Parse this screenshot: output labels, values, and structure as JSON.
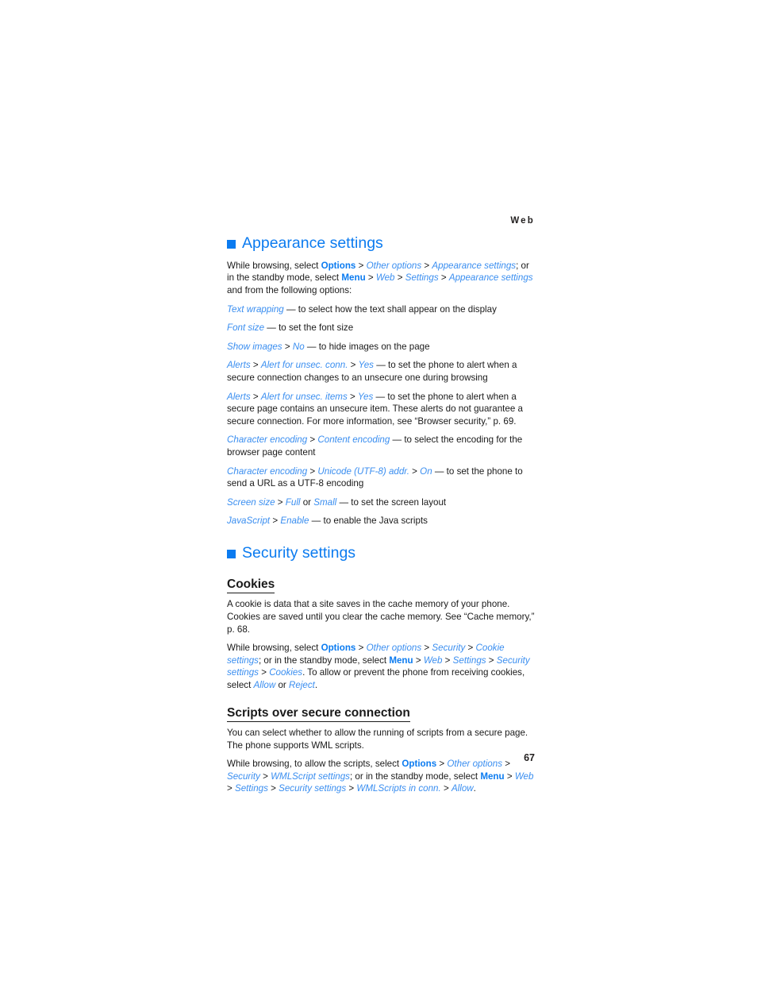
{
  "page": {
    "running_header": "Web",
    "folio": "67",
    "accent_blue": "#0b7bf0",
    "italic_blue": "#3a8ef0",
    "body_black": "#1a1a1a"
  },
  "sections": [
    {
      "id": "appearance-settings",
      "heading": "Appearance settings",
      "bullet": "square-bullet-icon",
      "intro": {
        "parts": [
          {
            "t": "plain",
            "v": "While browsing, select "
          },
          {
            "t": "bold",
            "v": "Options"
          },
          {
            "t": "sep",
            "v": " > "
          },
          {
            "t": "ital",
            "v": "Other options"
          },
          {
            "t": "sep",
            "v": " > "
          },
          {
            "t": "ital",
            "v": "Appearance settings"
          },
          {
            "t": "plain",
            "v": "; or in the standby mode, select "
          },
          {
            "t": "bold",
            "v": "Menu"
          },
          {
            "t": "sep",
            "v": " > "
          },
          {
            "t": "ital",
            "v": "Web"
          },
          {
            "t": "sep",
            "v": " > "
          },
          {
            "t": "ital",
            "v": "Settings"
          },
          {
            "t": "sep",
            "v": " > "
          },
          {
            "t": "ital",
            "v": "Appearance settings"
          },
          {
            "t": "plain",
            "v": " and from the following options:"
          }
        ]
      },
      "options": [
        {
          "parts": [
            {
              "t": "ital",
              "v": "Text wrapping"
            },
            {
              "t": "plain",
              "v": " — to select how the text shall appear on the display"
            }
          ]
        },
        {
          "parts": [
            {
              "t": "ital",
              "v": "Font size"
            },
            {
              "t": "plain",
              "v": " — to set the font size"
            }
          ]
        },
        {
          "parts": [
            {
              "t": "ital",
              "v": "Show images"
            },
            {
              "t": "sep",
              "v": " > "
            },
            {
              "t": "ital",
              "v": "No"
            },
            {
              "t": "plain",
              "v": " — to hide images on the page"
            }
          ]
        },
        {
          "parts": [
            {
              "t": "ital",
              "v": "Alerts"
            },
            {
              "t": "sep",
              "v": " > "
            },
            {
              "t": "ital",
              "v": "Alert for unsec. conn."
            },
            {
              "t": "sep",
              "v": " > "
            },
            {
              "t": "ital",
              "v": "Yes"
            },
            {
              "t": "plain",
              "v": " — to set the phone to alert when a secure connection changes to an unsecure one during browsing"
            }
          ]
        },
        {
          "parts": [
            {
              "t": "ital",
              "v": "Alerts"
            },
            {
              "t": "sep",
              "v": " > "
            },
            {
              "t": "ital",
              "v": "Alert for unsec. items"
            },
            {
              "t": "sep",
              "v": " > "
            },
            {
              "t": "ital",
              "v": "Yes"
            },
            {
              "t": "plain",
              "v": " — to set the phone to alert when a secure page contains an unsecure item. These alerts do not guarantee a secure connection. For more information, see “Browser security,” p. 69."
            }
          ]
        },
        {
          "parts": [
            {
              "t": "ital",
              "v": "Character encoding"
            },
            {
              "t": "sep",
              "v": " > "
            },
            {
              "t": "ital",
              "v": "Content encoding"
            },
            {
              "t": "plain",
              "v": " — to select the encoding for the browser page content"
            }
          ]
        },
        {
          "parts": [
            {
              "t": "ital",
              "v": "Character encoding"
            },
            {
              "t": "sep",
              "v": " > "
            },
            {
              "t": "ital",
              "v": "Unicode (UTF-8) addr."
            },
            {
              "t": "sep",
              "v": " > "
            },
            {
              "t": "ital",
              "v": "On"
            },
            {
              "t": "plain",
              "v": " — to set the phone to send a URL as a UTF-8 encoding"
            }
          ]
        },
        {
          "parts": [
            {
              "t": "ital",
              "v": "Screen size"
            },
            {
              "t": "sep",
              "v": " > "
            },
            {
              "t": "ital",
              "v": "Full"
            },
            {
              "t": "plain",
              "v": " or "
            },
            {
              "t": "ital",
              "v": "Small"
            },
            {
              "t": "plain",
              "v": " — to set the screen layout"
            }
          ]
        },
        {
          "parts": [
            {
              "t": "ital",
              "v": "JavaScript"
            },
            {
              "t": "sep",
              "v": " > "
            },
            {
              "t": "ital",
              "v": "Enable"
            },
            {
              "t": "plain",
              "v": " — to enable the Java scripts"
            }
          ]
        }
      ]
    },
    {
      "id": "security-settings",
      "heading": "Security settings",
      "bullet": "square-bullet-icon",
      "subsections": [
        {
          "id": "cookies",
          "heading": "Cookies",
          "paragraphs": [
            {
              "parts": [
                {
                  "t": "plain",
                  "v": "A cookie is data that a site saves in the cache memory of your phone. Cookies are saved until you clear the cache memory. See “Cache memory,” p. 68."
                }
              ]
            },
            {
              "parts": [
                {
                  "t": "plain",
                  "v": "While browsing, select "
                },
                {
                  "t": "bold",
                  "v": "Options"
                },
                {
                  "t": "sep",
                  "v": " > "
                },
                {
                  "t": "ital",
                  "v": "Other options"
                },
                {
                  "t": "sep",
                  "v": " > "
                },
                {
                  "t": "ital",
                  "v": "Security"
                },
                {
                  "t": "sep",
                  "v": " > "
                },
                {
                  "t": "ital",
                  "v": "Cookie settings"
                },
                {
                  "t": "plain",
                  "v": "; or in the standby mode, select "
                },
                {
                  "t": "bold",
                  "v": "Menu"
                },
                {
                  "t": "sep",
                  "v": " > "
                },
                {
                  "t": "ital",
                  "v": "Web"
                },
                {
                  "t": "sep",
                  "v": " > "
                },
                {
                  "t": "ital",
                  "v": "Settings"
                },
                {
                  "t": "sep",
                  "v": " > "
                },
                {
                  "t": "ital",
                  "v": "Security settings"
                },
                {
                  "t": "sep",
                  "v": " > "
                },
                {
                  "t": "ital",
                  "v": "Cookies"
                },
                {
                  "t": "plain",
                  "v": ". To allow or prevent the phone from receiving cookies, select "
                },
                {
                  "t": "ital",
                  "v": "Allow"
                },
                {
                  "t": "plain",
                  "v": " or "
                },
                {
                  "t": "ital",
                  "v": "Reject"
                },
                {
                  "t": "plain",
                  "v": "."
                }
              ]
            }
          ]
        },
        {
          "id": "scripts-over-secure-connection",
          "heading": "Scripts over secure connection",
          "paragraphs": [
            {
              "parts": [
                {
                  "t": "plain",
                  "v": "You can select whether to allow the running of scripts from a secure page. The phone supports WML scripts."
                }
              ]
            },
            {
              "parts": [
                {
                  "t": "plain",
                  "v": "While browsing, to allow the scripts, select "
                },
                {
                  "t": "bold",
                  "v": "Options"
                },
                {
                  "t": "sep",
                  "v": " > "
                },
                {
                  "t": "ital",
                  "v": "Other options"
                },
                {
                  "t": "sep",
                  "v": " > "
                },
                {
                  "t": "ital",
                  "v": "Security"
                },
                {
                  "t": "sep",
                  "v": " > "
                },
                {
                  "t": "ital",
                  "v": "WMLScript settings"
                },
                {
                  "t": "plain",
                  "v": "; or in the standby mode, select "
                },
                {
                  "t": "bold",
                  "v": "Menu"
                },
                {
                  "t": "sep",
                  "v": " > "
                },
                {
                  "t": "ital",
                  "v": "Web"
                },
                {
                  "t": "sep",
                  "v": " > "
                },
                {
                  "t": "ital",
                  "v": "Settings"
                },
                {
                  "t": "sep",
                  "v": " > "
                },
                {
                  "t": "ital",
                  "v": "Security settings"
                },
                {
                  "t": "sep",
                  "v": " > "
                },
                {
                  "t": "ital",
                  "v": "WMLScripts in conn."
                },
                {
                  "t": "sep",
                  "v": " > "
                },
                {
                  "t": "ital",
                  "v": "Allow"
                },
                {
                  "t": "plain",
                  "v": "."
                }
              ]
            }
          ]
        }
      ]
    }
  ]
}
